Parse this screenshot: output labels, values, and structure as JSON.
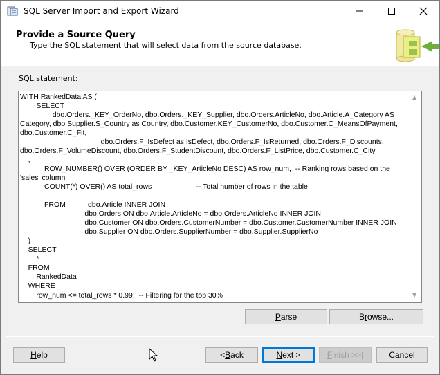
{
  "window": {
    "title": "SQL Server Import and Export Wizard"
  },
  "header": {
    "title": "Provide a Source Query",
    "subtitle": "Type the SQL statement that will select data from the source database."
  },
  "sql": {
    "label": "SQL statement:",
    "label_mnemonic": "S",
    "label_rest": "QL statement:",
    "text": "WITH RankedData AS (\n        SELECT\n                dbo.Orders._KEY_OrderNo, dbo.Orders._KEY_Supplier, dbo.Orders.ArticleNo, dbo.Article.A_Category AS Category, dbo.Supplier.S_Country as Country, dbo.Customer.KEY_CustomerNo, dbo.Customer.C_MeansOfPayment, dbo.Customer.C_Fit,\n                                        dbo.Orders.F_IsDefect as IsDefect, dbo.Orders.F_IsReturned, dbo.Orders.F_Discounts, dbo.Orders.F_VolumeDiscount, dbo.Orders.F_StudentDiscount, dbo.Orders.F_ListPrice, dbo.Customer.C_City\n    ,\n            ROW_NUMBER() OVER (ORDER BY _KEY_ArticleNo DESC) AS row_num,  -- Ranking rows based on the 'sales' column\n            COUNT(*) OVER() AS total_rows                      -- Total number of rows in the table\n\n            FROM           dbo.Article INNER JOIN\n                                dbo.Orders ON dbo.Article.ArticleNo = dbo.Orders.ArticleNo INNER JOIN\n                                dbo.Customer ON dbo.Orders.CustomerNumber = dbo.Customer.CustomerNumber INNER JOIN\n                                dbo.Supplier ON dbo.Orders.SupplierNumber = dbo.Supplier.SupplierNo\n    )\n    SELECT\n        *\n    FROM\n        RankedData\n    WHERE\n        row_num <= total_rows * 0.99;  -- Filtering for the top 30%"
  },
  "buttons": {
    "parse": "Parse",
    "browse": "Browse...",
    "help": "Help",
    "back": "< Back",
    "next": "Next >",
    "finish": "Finish >>|",
    "cancel": "Cancel"
  },
  "icons": {
    "app": "wizard-app-icon",
    "minimize": "minimize-icon",
    "maximize": "maximize-icon",
    "close": "close-icon",
    "header": "wizard-database-icon"
  }
}
